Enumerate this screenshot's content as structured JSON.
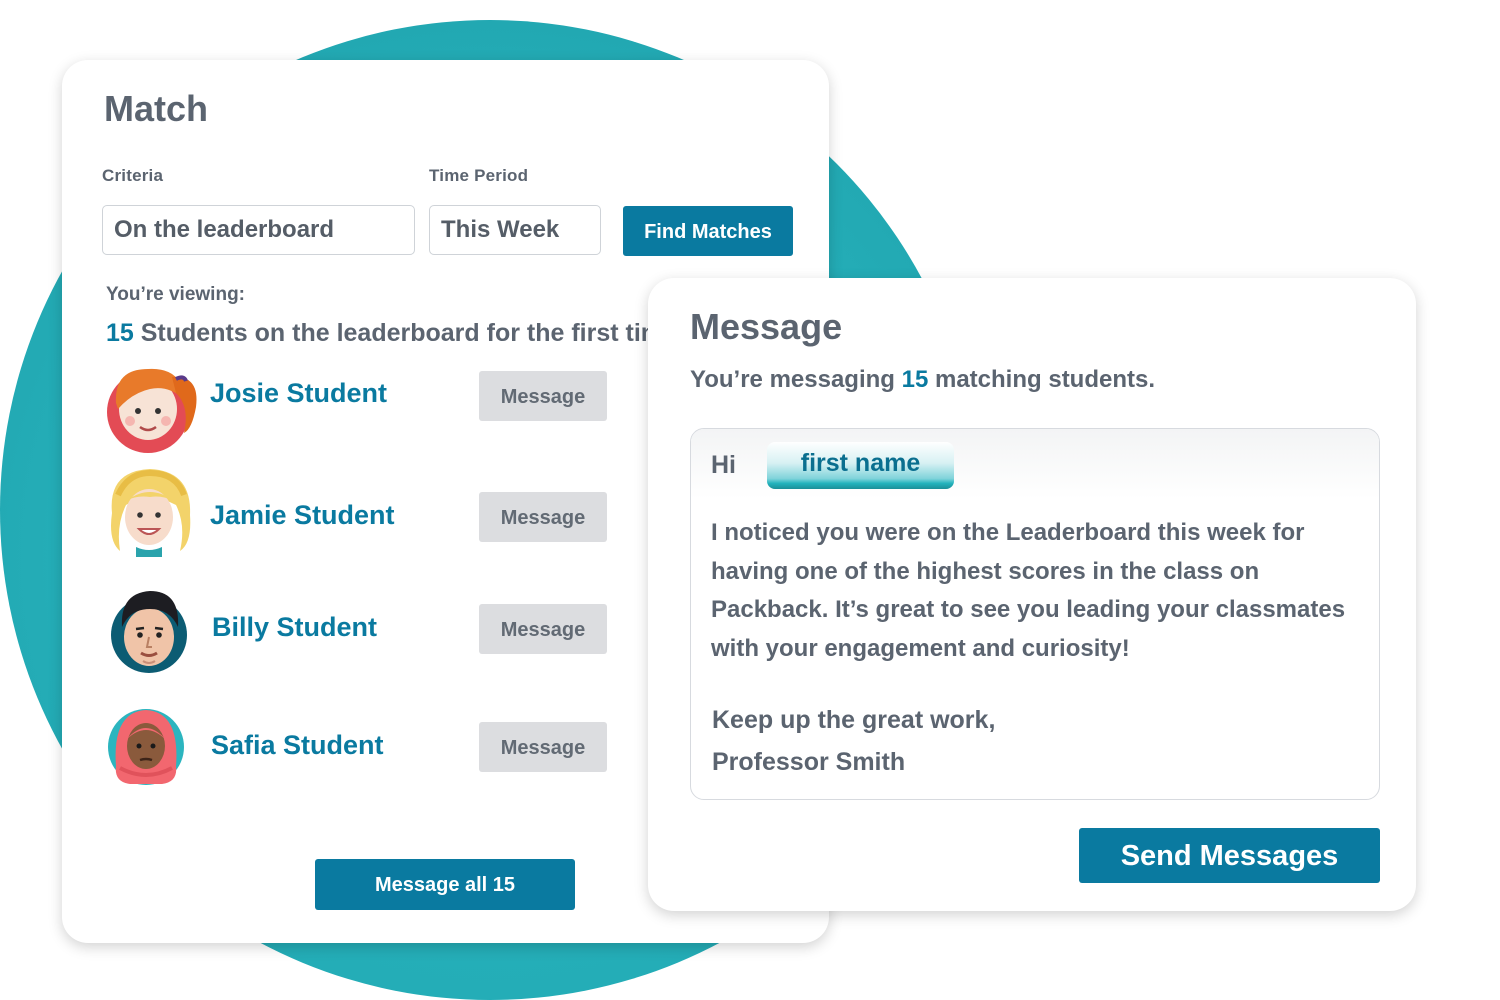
{
  "colors": {
    "accent": "#0a7aa0",
    "teal_circle": "#24adb7",
    "gray_button": "#dcdde0",
    "text": "#5b6470"
  },
  "match": {
    "title": "Match",
    "criteria_label": "Criteria",
    "criteria_value": "On the leaderboard",
    "time_label": "Time Period",
    "time_value": "This Week",
    "find_button": "Find Matches",
    "viewing_label": "You’re viewing:",
    "viewing_count": "15",
    "viewing_text": " Students on the leaderboard for the first time",
    "students": [
      {
        "name": "Josie Student",
        "button": "Message",
        "avatar": "josie-avatar"
      },
      {
        "name": "Jamie Student",
        "button": "Message",
        "avatar": "jamie-avatar"
      },
      {
        "name": "Billy Student",
        "button": "Message",
        "avatar": "billy-avatar"
      },
      {
        "name": "Safia Student",
        "button": "Message",
        "avatar": "safia-avatar"
      }
    ],
    "message_all_button": "Message all 15"
  },
  "message": {
    "title": "Message",
    "sub_prefix": "You’re messaging ",
    "sub_count": "15",
    "sub_suffix": " matching students.",
    "greeting": "Hi",
    "token": "first name",
    "body": "I noticed you were on the Leaderboard this week for having one of the highest scores in the class on Packback. It’s great to see you leading your classmates with your engagement and curiosity!",
    "closing_line1": "Keep up the great work,",
    "closing_line2": "Professor Smith",
    "send_button": "Send Messages"
  }
}
